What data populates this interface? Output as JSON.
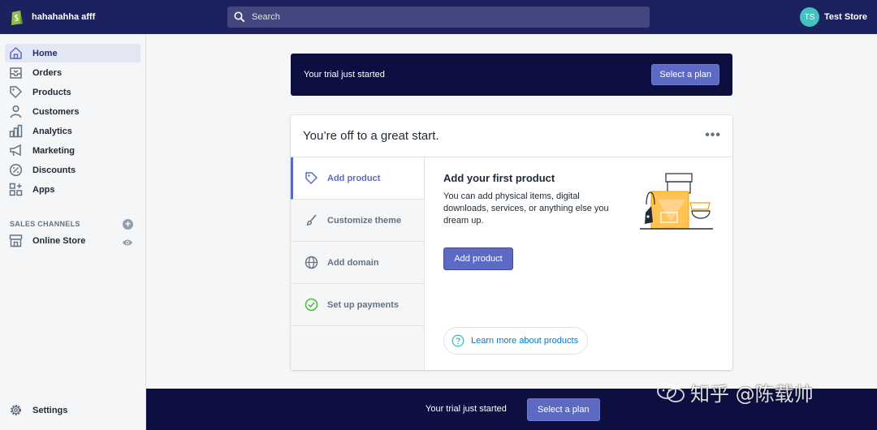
{
  "topbar": {
    "store_name": "hahahahha afff",
    "search_placeholder": "Search",
    "user_initials": "TS",
    "user_store": "Test Store"
  },
  "sidebar": {
    "items": [
      {
        "label": "Home",
        "icon": "home-icon"
      },
      {
        "label": "Orders",
        "icon": "orders-icon"
      },
      {
        "label": "Products",
        "icon": "tag-icon"
      },
      {
        "label": "Customers",
        "icon": "person-icon"
      },
      {
        "label": "Analytics",
        "icon": "bar-chart-icon"
      },
      {
        "label": "Marketing",
        "icon": "megaphone-icon"
      },
      {
        "label": "Discounts",
        "icon": "discount-icon"
      },
      {
        "label": "Apps",
        "icon": "apps-icon"
      }
    ],
    "sales_channels_label": "SALES CHANNELS",
    "online_store_label": "Online Store",
    "settings_label": "Settings"
  },
  "banner": {
    "text": "Your trial just started",
    "button": "Select a plan"
  },
  "card": {
    "title": "You’re off to a great start.",
    "more": "•••",
    "steps": [
      {
        "label": "Add product",
        "icon": "tag-icon"
      },
      {
        "label": "Customize theme",
        "icon": "brush-icon"
      },
      {
        "label": "Add domain",
        "icon": "globe-icon"
      },
      {
        "label": "Set up payments",
        "icon": "check-circle-icon"
      }
    ],
    "content_title": "Add your first product",
    "content_desc": "You can add physical items, digital downloads, services, or anything else you dream up.",
    "add_button": "Add product",
    "learn_more": "Learn more about products"
  },
  "bottom_bar": {
    "text": "Your trial just started",
    "button": "Select a plan"
  },
  "watermark": {
    "text": "知乎 @陈载帅"
  },
  "colors": {
    "topbar": "#1c2260",
    "banner": "#0d0f40",
    "accent": "#5c6ac4",
    "avatar": "#47c1bf",
    "success": "#50b83c"
  }
}
